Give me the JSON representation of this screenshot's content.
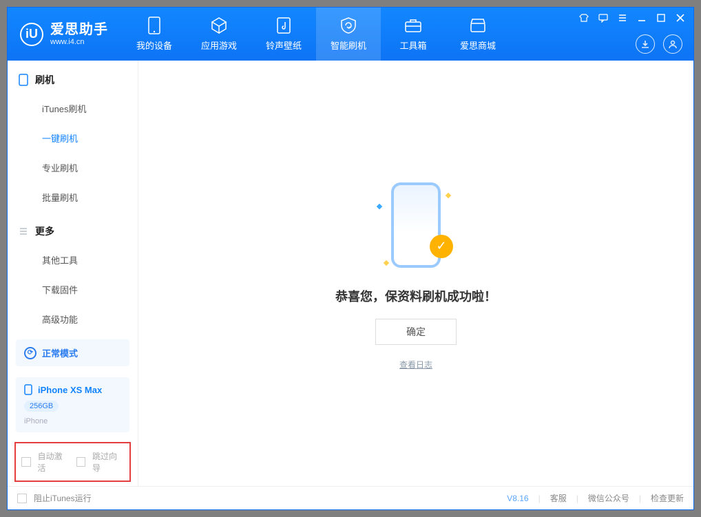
{
  "app": {
    "title": "爱思助手",
    "subtitle": "www.i4.cn",
    "logo_letter": "iU"
  },
  "nav": [
    {
      "key": "my-device",
      "label": "我的设备"
    },
    {
      "key": "apps-games",
      "label": "应用游戏"
    },
    {
      "key": "ringtone-wallpaper",
      "label": "铃声壁纸"
    },
    {
      "key": "smart-flash",
      "label": "智能刷机",
      "active": true
    },
    {
      "key": "toolbox",
      "label": "工具箱"
    },
    {
      "key": "aisi-store",
      "label": "爱思商城"
    }
  ],
  "sidebar": {
    "groups": [
      {
        "key": "flash",
        "title": "刷机",
        "items": [
          {
            "key": "itunes-flash",
            "label": "iTunes刷机"
          },
          {
            "key": "one-click-flash",
            "label": "一键刷机",
            "active": true
          },
          {
            "key": "pro-flash",
            "label": "专业刷机"
          },
          {
            "key": "batch-flash",
            "label": "批量刷机"
          }
        ]
      },
      {
        "key": "more",
        "title": "更多",
        "items": [
          {
            "key": "other-tools",
            "label": "其他工具"
          },
          {
            "key": "download-firmware",
            "label": "下载固件"
          },
          {
            "key": "advanced",
            "label": "高级功能"
          }
        ]
      }
    ],
    "mode": {
      "label": "正常模式"
    },
    "device": {
      "name": "iPhone XS Max",
      "capacity": "256GB",
      "type": "iPhone"
    },
    "options": {
      "auto_activate": "自动激活",
      "skip_wizard": "跳过向导"
    }
  },
  "main": {
    "success_text": "恭喜您，保资料刷机成功啦！",
    "ok_btn": "确定",
    "view_log": "查看日志"
  },
  "status": {
    "block_itunes": "阻止iTunes运行",
    "version": "V8.16",
    "support": "客服",
    "wechat": "微信公众号",
    "check_update": "检查更新"
  }
}
